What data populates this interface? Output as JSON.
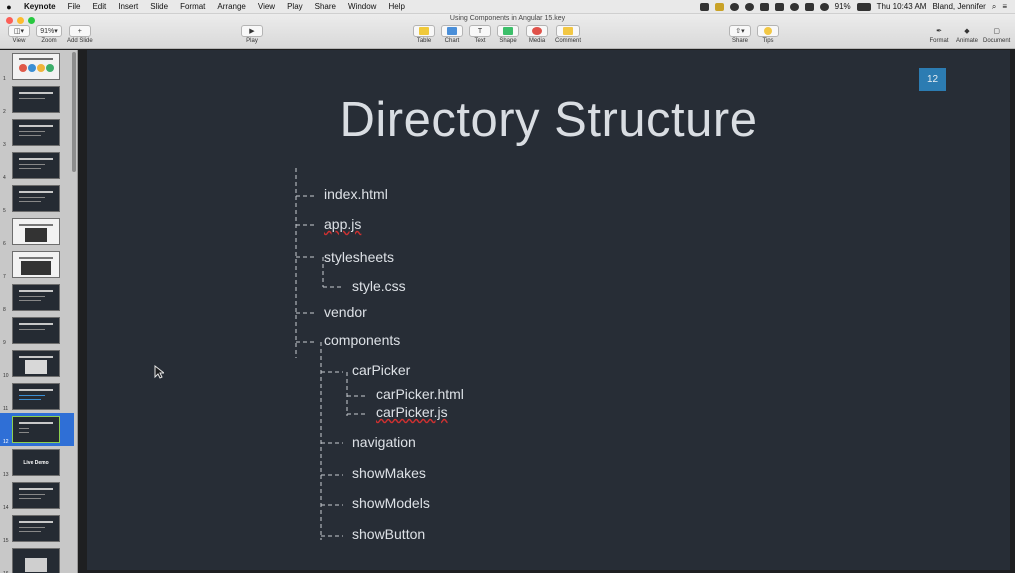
{
  "menubar": {
    "apple": "",
    "app_name": "Keynote",
    "items": [
      "File",
      "Edit",
      "Insert",
      "Slide",
      "Format",
      "Arrange",
      "View",
      "Play",
      "Share",
      "Window",
      "Help"
    ],
    "battery": "91%",
    "clock": "Thu 10:43 AM",
    "user": "Bland, Jennifer"
  },
  "window": {
    "title": "Using Components in Angular 15.key",
    "toolbar": {
      "view_label": "View",
      "zoom_value": "91%",
      "zoom_label": "Zoom",
      "add_slide_label": "Add Slide",
      "play_label": "Play",
      "insert": [
        "Table",
        "Chart",
        "Text",
        "Shape",
        "Media",
        "Comment"
      ],
      "share_label": "Share",
      "tips_label": "Tips",
      "right": [
        "Format",
        "Animate",
        "Document"
      ]
    }
  },
  "navigator": {
    "slides": [
      {
        "num": "1"
      },
      {
        "num": "2"
      },
      {
        "num": "3"
      },
      {
        "num": "4"
      },
      {
        "num": "5"
      },
      {
        "num": "6"
      },
      {
        "num": "7"
      },
      {
        "num": "8"
      },
      {
        "num": "9"
      },
      {
        "num": "10"
      },
      {
        "num": "11"
      },
      {
        "num": "12"
      },
      {
        "num": "13",
        "caption": "Live Demo"
      },
      {
        "num": "14"
      },
      {
        "num": "15"
      },
      {
        "num": "16"
      }
    ],
    "selected": "12"
  },
  "slide": {
    "number": "12",
    "title": "Directory Structure",
    "tree": {
      "index_html": "index.html",
      "app_js": "app.js",
      "stylesheets": "stylesheets",
      "style_css": "style.css",
      "vendor": "vendor",
      "components": "components",
      "carpicker": "carPicker",
      "carpicker_html": "carPicker.html",
      "carpicker_js": "carPicker.js",
      "navigation": "navigation",
      "showmakes": "showMakes",
      "showmodels": "showModels",
      "showbutton": "showButton"
    }
  },
  "colors": {
    "slide_bg": "#272d36",
    "slide_number_bg": "#2c7cb2",
    "selection": "#2f6fd6",
    "spellcheck": "#d03030"
  }
}
